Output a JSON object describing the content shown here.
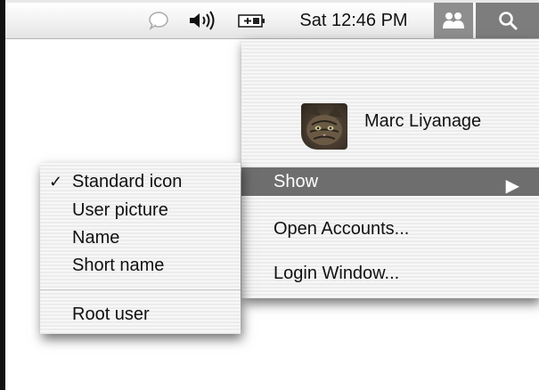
{
  "menubar": {
    "ichat_icon": "speech-bubble-icon",
    "volume_icon": "speaker-volume-icon",
    "battery_icon": "battery-icon",
    "clock": "Sat 12:46 PM",
    "user_icon": "fast-user-switching-icon",
    "search_icon": "spotlight-search-icon"
  },
  "user_menu": {
    "user_name": "Marc Liyanage",
    "avatar_icon": "cat-picture",
    "items": {
      "show": "Show",
      "open_accounts": "Open Accounts...",
      "login_window": "Login Window..."
    },
    "submenu_arrow": "▶"
  },
  "show_submenu": {
    "check": "✓",
    "items": [
      "Standard icon",
      "User picture",
      "Name",
      "Short name"
    ],
    "root_user": "Root user",
    "checked_item": "Standard icon"
  },
  "colors": {
    "highlight": "#6e6e6e",
    "menu_bg": "#f2f2f2"
  }
}
